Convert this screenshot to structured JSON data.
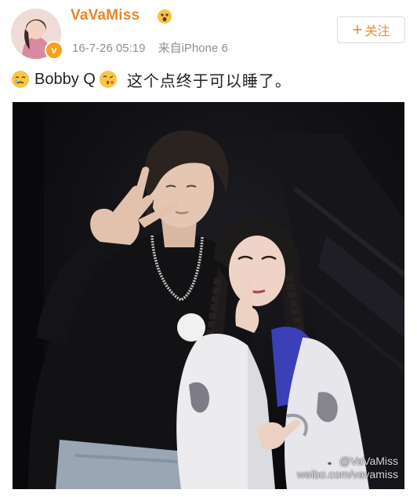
{
  "post": {
    "author": {
      "username": "VaVaMiss",
      "verified_badge": "v"
    },
    "meta": {
      "timestamp": "16-7-26 05:19",
      "source": "来自iPhone 6"
    },
    "follow_button": {
      "plus": "+",
      "label": "关注"
    },
    "text": {
      "part1": "Bobby Q",
      "part2": "这个点终于可以睡了。"
    },
    "watermark": {
      "handle": "@VaVaMiss",
      "url": "weibo.com/vavamiss"
    },
    "colors": {
      "username": "#e8862a",
      "follow_text": "#ef8a2a",
      "meta": "#8f8f8f",
      "verified": "#f6a11b"
    },
    "icons": {
      "name_badge": "surprised-face-icon",
      "emoji1": "crying-face-icon",
      "emoji2": "kissing-face-icon",
      "verified": "verified-badge-icon",
      "watermark": "weibo-logo-icon"
    }
  }
}
